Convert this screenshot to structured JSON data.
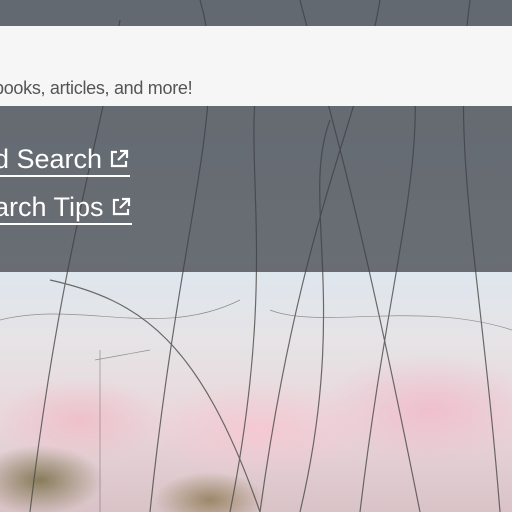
{
  "search": {
    "placeholder_text": "books, articles, and more!"
  },
  "links": {
    "advanced_search": "d Search",
    "search_tips": "arch Tips"
  },
  "icons": {
    "external_link": "external-link-icon"
  },
  "colors": {
    "overlay": "#3c3e44",
    "search_bg": "#f6f6f6",
    "link_text": "#ffffff"
  }
}
